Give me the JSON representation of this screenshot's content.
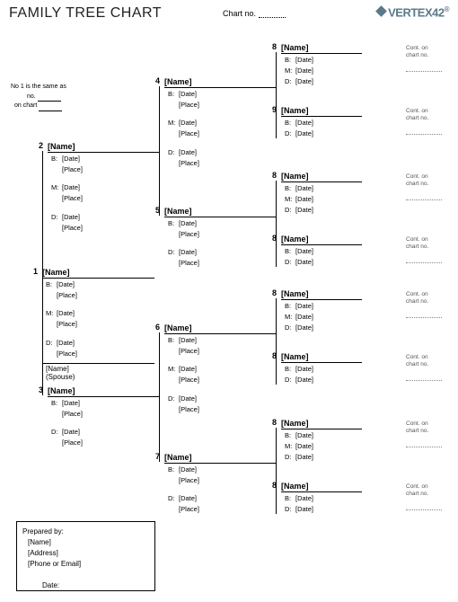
{
  "doc": {
    "title": "FAMILY TREE CHART",
    "chart_no_label": "Chart no.",
    "logo": "VERTEX42",
    "continue_note_a": "No 1 is the same as",
    "continue_note_b": "no.",
    "continue_note_c": "on chart",
    "prepared_label": "Prepared by:",
    "prepared_name": "[Name]",
    "prepared_address": "[Address]",
    "prepared_contact": "[Phone or Email]",
    "prepared_date": "Date:",
    "cont_label": "Cont. on chart no."
  },
  "fields": {
    "name": "[Name]",
    "b": "B:",
    "m": "M:",
    "d": "D:",
    "date": "[Date]",
    "place": "[Place]",
    "spouse": "(Spouse)"
  },
  "nums": {
    "p1": "1",
    "p2": "2",
    "p3": "3",
    "p4": "4",
    "p5": "5",
    "p6": "6",
    "p7": "7",
    "p8": "8",
    "p9": "9"
  }
}
